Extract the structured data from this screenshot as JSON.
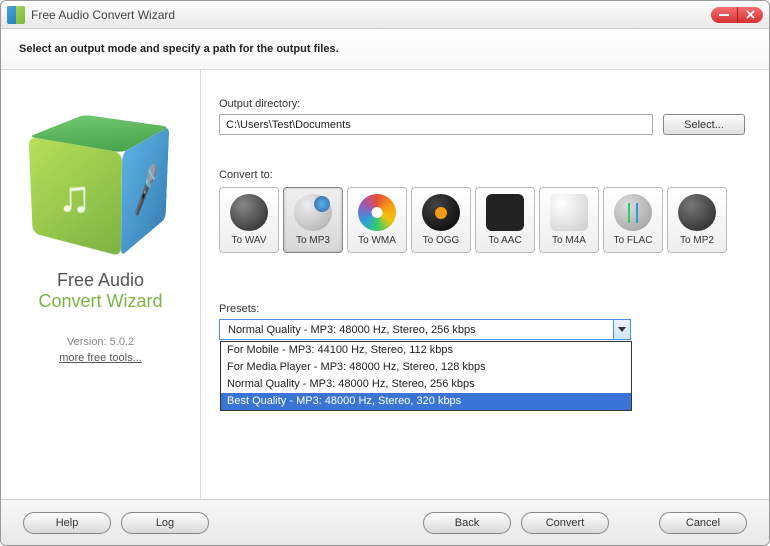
{
  "titlebar": {
    "title": "Free Audio Convert Wizard"
  },
  "instruction": "Select an output mode and specify a path for the output files.",
  "sidebar": {
    "name_line1": "Free Audio",
    "name_line2": "Convert Wizard",
    "version": "Version: 5.0.2",
    "more_tools": "more free tools..."
  },
  "output": {
    "label": "Output directory:",
    "value": "C:\\Users\\Test\\Documents",
    "select_btn": "Select..."
  },
  "convert": {
    "label": "Convert to:",
    "formats": [
      {
        "label": "To WAV",
        "id": "wav"
      },
      {
        "label": "To MP3",
        "id": "mp3"
      },
      {
        "label": "To WMA",
        "id": "wma"
      },
      {
        "label": "To OGG",
        "id": "ogg"
      },
      {
        "label": "To AAC",
        "id": "aac"
      },
      {
        "label": "To M4A",
        "id": "m4a"
      },
      {
        "label": "To FLAC",
        "id": "flac"
      },
      {
        "label": "To MP2",
        "id": "mp2"
      }
    ],
    "selected": "mp3"
  },
  "presets": {
    "label": "Presets:",
    "selected": "Normal Quality - MP3: 48000 Hz, Stereo, 256 kbps",
    "options": [
      "For Mobile - MP3: 44100 Hz, Stereo, 112 kbps",
      "For Media Player - MP3: 48000 Hz, Stereo, 128 kbps",
      "Normal Quality - MP3: 48000 Hz, Stereo, 256 kbps",
      "Best Quality - MP3: 48000 Hz, Stereo, 320 kbps"
    ],
    "highlighted_index": 3
  },
  "footer": {
    "help": "Help",
    "log": "Log",
    "back": "Back",
    "convert": "Convert",
    "cancel": "Cancel"
  }
}
